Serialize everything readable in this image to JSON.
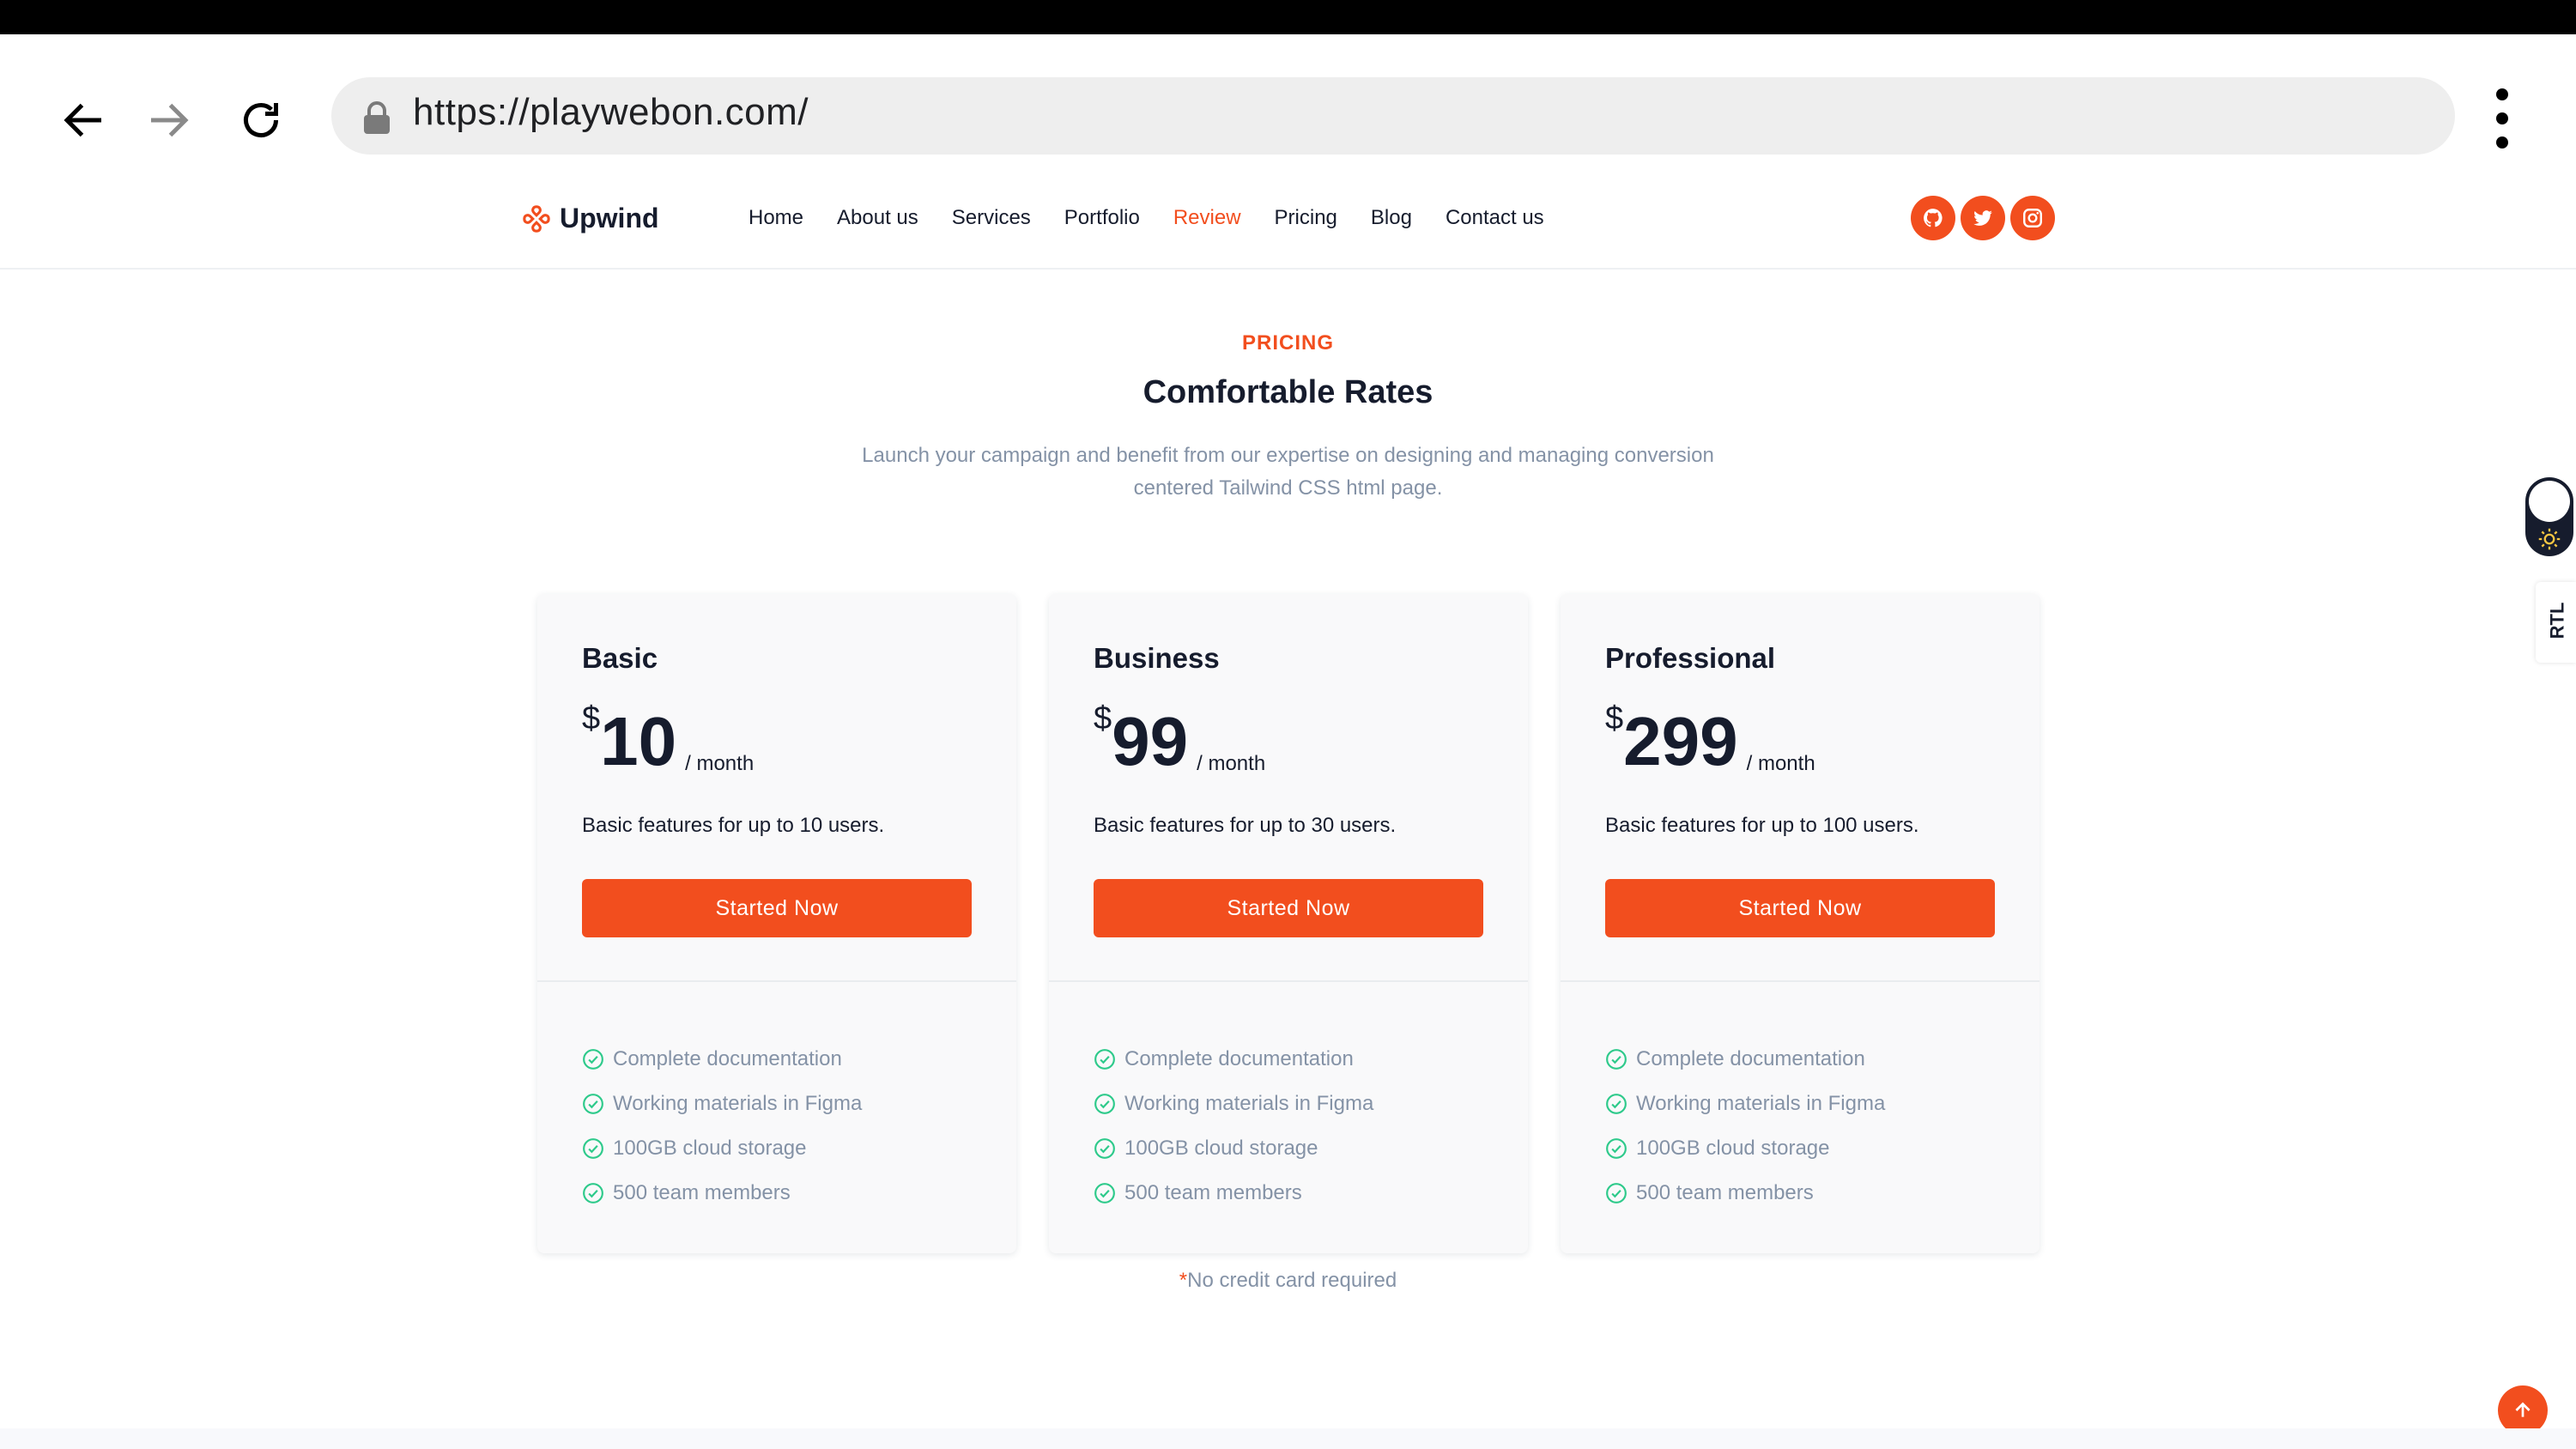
{
  "browser": {
    "url": "https://playwebon.com/",
    "icons": [
      "back-arrow-icon",
      "forward-arrow-icon",
      "reload-icon",
      "lock-icon",
      "more-vert-icon"
    ]
  },
  "header": {
    "logo_text": "Upwind",
    "menu": [
      {
        "label": "Home"
      },
      {
        "label": "About us"
      },
      {
        "label": "Services"
      },
      {
        "label": "Portfolio"
      },
      {
        "label": "Review"
      },
      {
        "label": "Pricing"
      },
      {
        "label": "Blog"
      },
      {
        "label": "Contact us"
      }
    ],
    "active_menu": "Review",
    "socials": [
      "github-icon",
      "twitter-icon",
      "instagram-icon"
    ]
  },
  "section": {
    "eyebrow": "PRICING",
    "title": "Comfortable Rates",
    "subtitle": "Launch your campaign and benefit from our expertise on designing and managing conversion centered Tailwind CSS html page."
  },
  "plans": [
    {
      "name": "Basic",
      "currency": "$",
      "amount": "10",
      "period": "/ month",
      "description": "Basic features for up to 10 users.",
      "cta": "Started Now",
      "features": [
        "Complete documentation",
        "Working materials in Figma",
        "100GB cloud storage",
        "500 team members"
      ]
    },
    {
      "name": "Business",
      "currency": "$",
      "amount": "99",
      "period": "/ month",
      "description": "Basic features for up to 30 users.",
      "cta": "Started Now",
      "features": [
        "Complete documentation",
        "Working materials in Figma",
        "100GB cloud storage",
        "500 team members"
      ]
    },
    {
      "name": "Professional",
      "currency": "$",
      "amount": "299",
      "period": "/ month",
      "description": "Basic features for up to 100 users.",
      "cta": "Started Now",
      "features": [
        "Complete documentation",
        "Working materials in Figma",
        "100GB cloud storage",
        "500 team members"
      ]
    }
  ],
  "footnote": {
    "star": "*",
    "text": "No credit card required"
  },
  "widgets": {
    "rtl_label": "RTL",
    "theme_icon": "sun-icon",
    "back_to_top_icon": "arrow-up-icon"
  },
  "colors": {
    "accent": "#f24e1e",
    "text": "#161c2d",
    "muted": "#8492a6",
    "check": "#2eca8b"
  }
}
